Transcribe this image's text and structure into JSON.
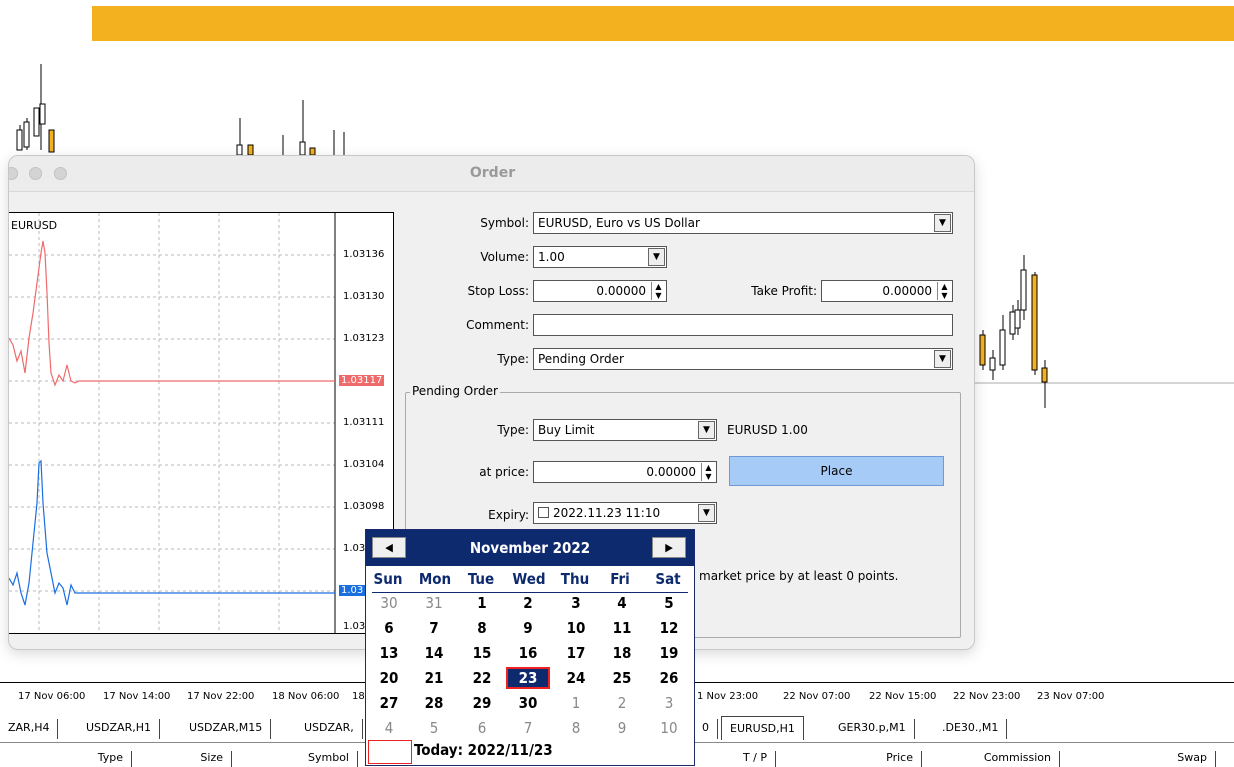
{
  "dialog": {
    "title": "Order",
    "mini_chart": {
      "symbol": "EURUSD",
      "prices": [
        "1.03136",
        "1.03130",
        "1.03123",
        "1.03117",
        "1.03111",
        "1.03104",
        "1.03098",
        "1.03",
        "1.03",
        "1.03"
      ]
    },
    "symbol_label": "Symbol:",
    "symbol_value": "EURUSD, Euro vs US Dollar",
    "volume_label": "Volume:",
    "volume_value": "1.00",
    "stop_loss_label": "Stop Loss:",
    "stop_loss_value": "0.00000",
    "take_profit_label": "Take Profit:",
    "take_profit_value": "0.00000",
    "comment_label": "Comment:",
    "comment_value": "",
    "type_label": "Type:",
    "type_value": "Pending Order",
    "pending": {
      "group_title": "Pending Order",
      "type_label": "Type:",
      "type_value": "Buy Limit",
      "summary": "EURUSD 1.00",
      "at_price_label": "at price:",
      "at_price_value": "0.00000",
      "place_label": "Place",
      "expiry_label": "Expiry:",
      "expiry_value": "2022.11.23 11:10",
      "note": "market price by at least 0 points."
    }
  },
  "calendar": {
    "month": "November 2022",
    "prev_icon": "left-arrow-icon",
    "next_icon": "right-arrow-icon",
    "weekdays": [
      "Sun",
      "Mon",
      "Tue",
      "Wed",
      "Thu",
      "Fri",
      "Sat"
    ],
    "weeks": [
      [
        "30",
        "31",
        "1",
        "2",
        "3",
        "4",
        "5"
      ],
      [
        "6",
        "7",
        "8",
        "9",
        "10",
        "11",
        "12"
      ],
      [
        "13",
        "14",
        "15",
        "16",
        "17",
        "18",
        "19"
      ],
      [
        "20",
        "21",
        "22",
        "23",
        "24",
        "25",
        "26"
      ],
      [
        "27",
        "28",
        "29",
        "30",
        "1",
        "2",
        "3"
      ],
      [
        "4",
        "5",
        "6",
        "7",
        "8",
        "9",
        "10"
      ]
    ],
    "selected": "23",
    "today_text": "Today: 2022/11/23"
  },
  "time_axis": [
    "17 Nov 06:00",
    "17 Nov 14:00",
    "17 Nov 22:00",
    "18 Nov 06:00",
    "18",
    "1 Nov 23:00",
    "22 Nov 07:00",
    "22 Nov 15:00",
    "22 Nov 23:00",
    "23 Nov 07:00"
  ],
  "tabs": [
    "ZAR,H4",
    "USDZAR,H1",
    "USDZAR,M15",
    "USDZAR,",
    "0",
    "EURUSD,H1",
    "GER30.p,M1",
    ".DE30.,M1"
  ],
  "active_tab": "EURUSD,H1",
  "columns": [
    "Type",
    "Size",
    "Symbol",
    "T / P",
    "Price",
    "Commission",
    "Swap"
  ],
  "colors": {
    "topbar": "#f3b01f",
    "calendar_header": "#0e2a6e",
    "bid_line": "#ef6b6b",
    "ask_line": "#1a6fe0",
    "place_button": "#a7cbf7"
  }
}
